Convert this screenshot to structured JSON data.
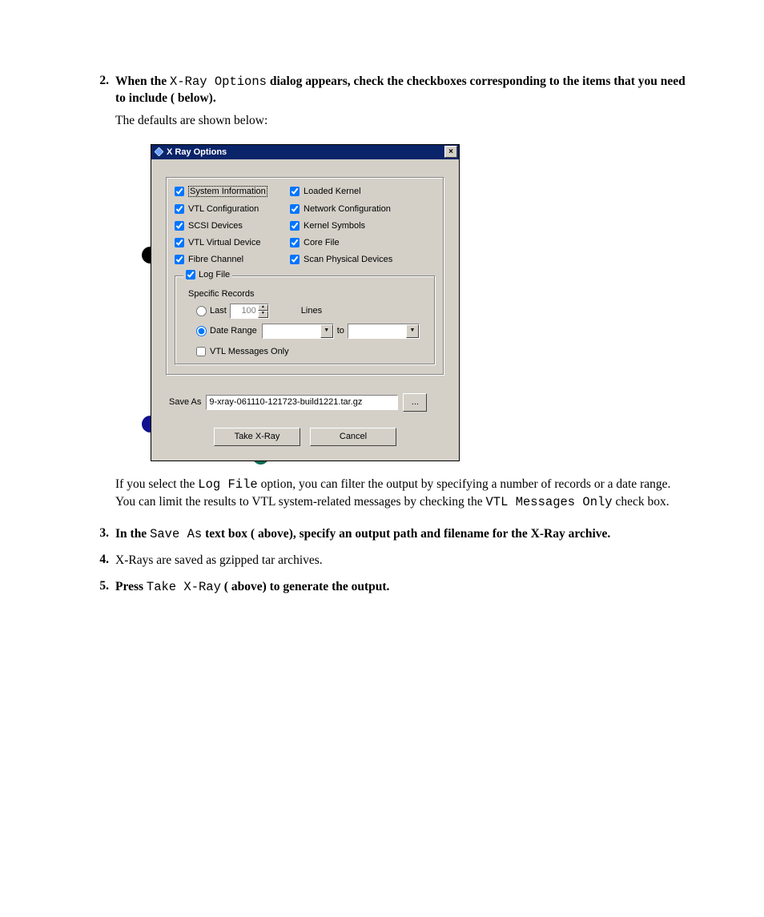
{
  "steps": {
    "s2": {
      "num": "2.",
      "pre": "When the ",
      "code": "X-Ray Options",
      "post": " dialog appears, check the checkboxes corresponding to the items that you need to include (   below).",
      "sub": "The defaults are shown below:"
    },
    "s3": {
      "num": "3.",
      "pre": "In the ",
      "code": "Save As",
      "post": " text box (   above), specify an output path and filename for the X-Ray archive."
    },
    "s4": {
      "num": "4.",
      "text": "X-Rays are saved as gzipped tar archives."
    },
    "s5": {
      "num": "5.",
      "pre": "Press ",
      "code": "Take X-Ray",
      "post": " (   above) to generate the output."
    }
  },
  "after_dialog": {
    "t1a": "If you select the ",
    "t1code": "Log File",
    "t1b": " option, you can filter the output by specifying a number of records or a date range. You can limit the results to VTL system-related messages by checking the ",
    "t1code2": "VTL Messages Only",
    "t1c": " check box."
  },
  "dialog": {
    "title": "X Ray Options",
    "close": "×",
    "checks": {
      "sysinfo": "System Information",
      "loadedkernel": "Loaded Kernel",
      "vtlconfig": "VTL Configuration",
      "netconfig": "Network Configuration",
      "scsi": "SCSI Devices",
      "ksymbols": "Kernel Symbols",
      "vtlvdev": "VTL Virtual Device",
      "corefile": "Core File",
      "fibre": "Fibre Channel",
      "scanphys": "Scan Physical Devices"
    },
    "logfile": {
      "legend": "Log File",
      "specific": "Specific Records",
      "last": "Last",
      "last_value": "100",
      "lines": "Lines",
      "daterange": "Date Range",
      "to": "to",
      "vtl_only": "VTL Messages Only"
    },
    "save_as_label": "Save As",
    "save_as_value": "9-xray-061110-121723-build1221.tar.gz",
    "browse": "...",
    "take": "Take X-Ray",
    "cancel": "Cancel"
  }
}
